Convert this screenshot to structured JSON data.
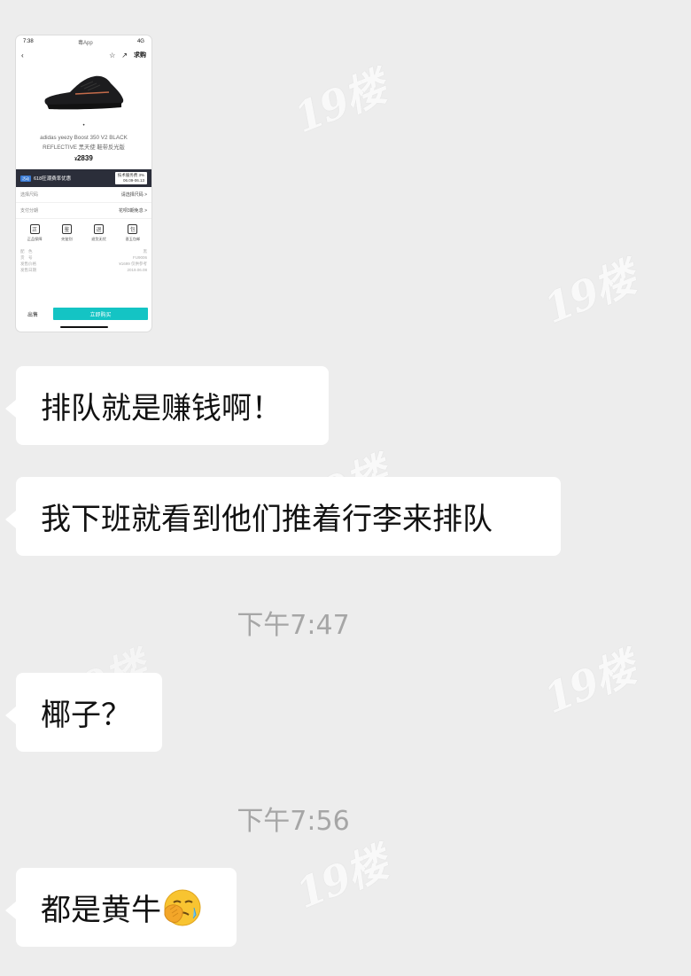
{
  "screenshot": {
    "status_time": "7:38",
    "status_app": "毒App",
    "status_signal": "4G",
    "nav_buy": "求购",
    "dot": "•",
    "product_name_line1": "adidas yeezy Boost 350 V2 BLACK",
    "product_name_line2": "REFLECTIVE 黑天使 鞋带反光版",
    "currency": "¥",
    "price": "2839",
    "promo_tag": "活动",
    "promo_text": "618狂潮费率优惠",
    "promo_right_line1": "技术服务费 3%",
    "promo_right_line2": "06.09-06.13",
    "row1_label": "选择尺码",
    "row1_value": "请选择尺码  >",
    "row2_label": "支付分期",
    "row2_value": "花呗3期免息  >",
    "icons": [
      {
        "label": "正品保障",
        "glyph": "正"
      },
      {
        "label": "先鉴别",
        "glyph": "鉴"
      },
      {
        "label": "退货无忧",
        "glyph": "退"
      },
      {
        "label": "晋玉包邮",
        "glyph": "包"
      }
    ],
    "specs": [
      {
        "k": "配　色",
        "v": "黑"
      },
      {
        "k": "货　号",
        "v": "FU9006"
      },
      {
        "k": "发售价格",
        "v": "¥1699 仅供参考"
      },
      {
        "k": "发售日期",
        "v": "2019.06.08"
      }
    ],
    "sell_label": "出售",
    "buy_now_label": "立即购买"
  },
  "messages": [
    {
      "text": "排队就是赚钱啊！"
    },
    {
      "text": "我下班就看到他们推着行李来排队"
    },
    {
      "text": "椰子？"
    },
    {
      "text": "都是黄牛"
    }
  ],
  "timestamps": [
    "下午7:47",
    "下午7:56"
  ],
  "watermark": "19楼",
  "emoji_icon": "facepalm-emoji-icon"
}
